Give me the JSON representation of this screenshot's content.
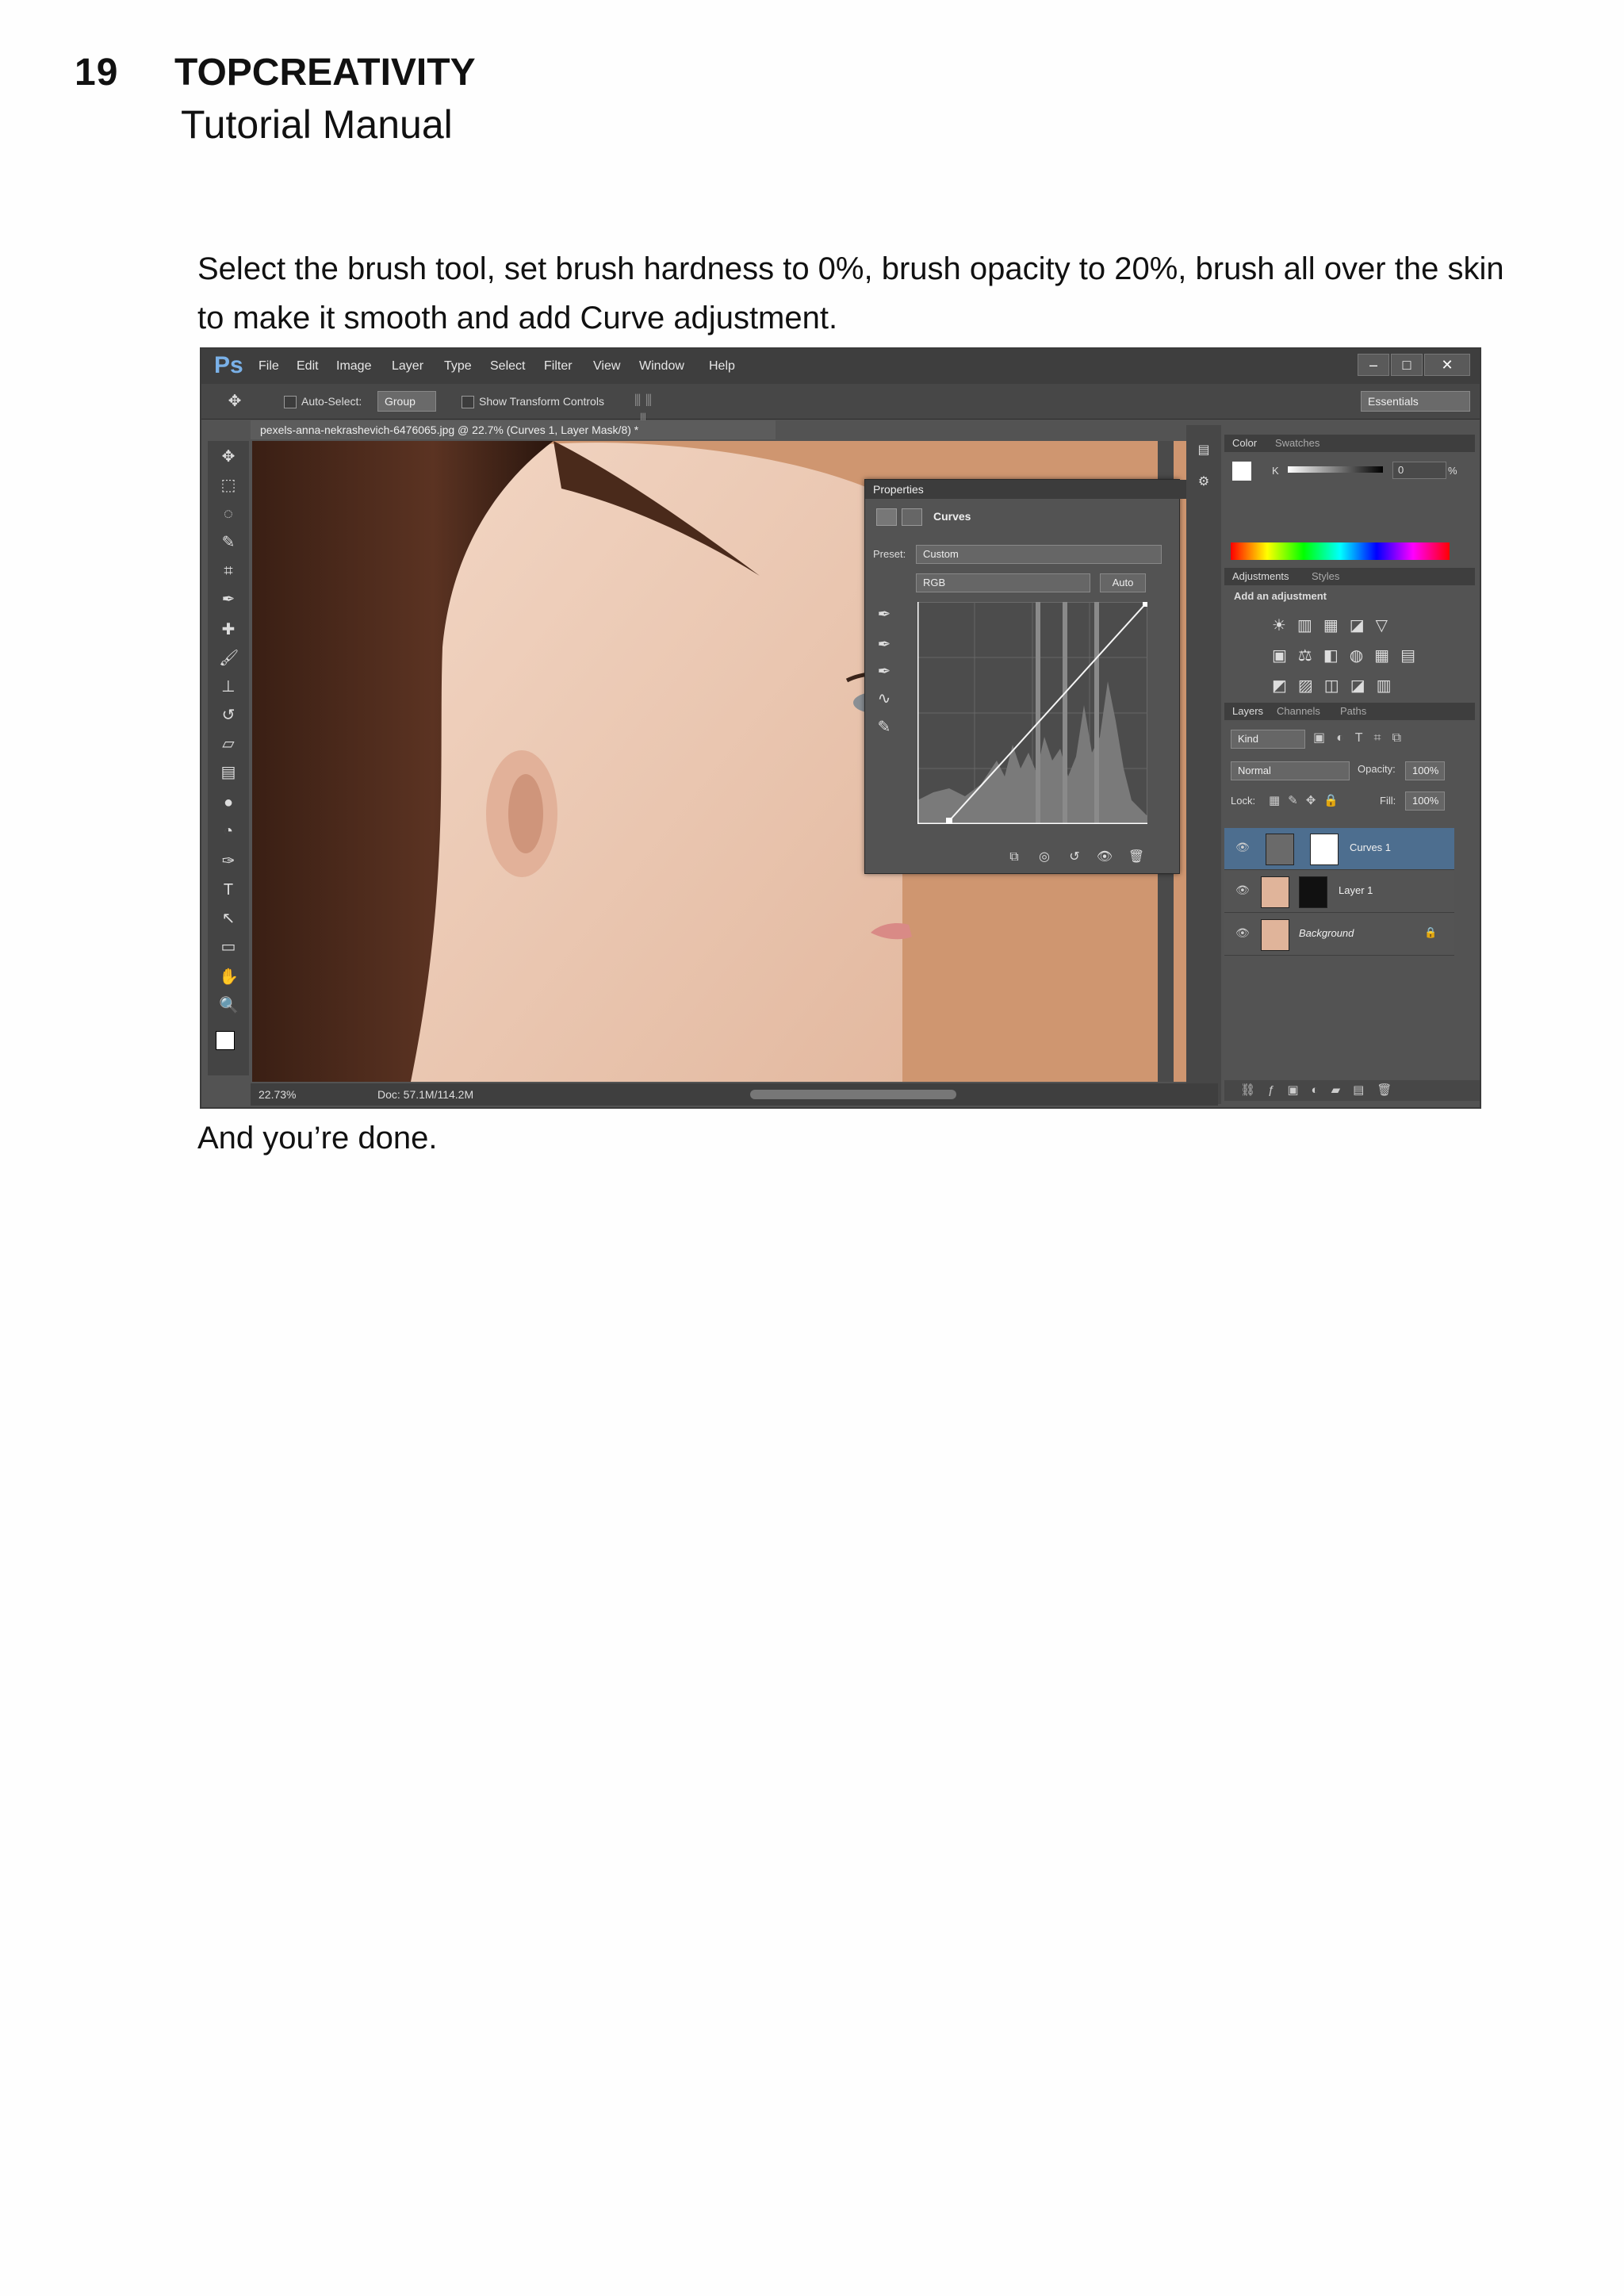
{
  "header": {
    "page_number": "19",
    "brand": "TOPCREATIVITY",
    "subtitle": "Tutorial Manual"
  },
  "paragraphs": {
    "instruction": "Select the brush tool, set brush hardness to 0%, brush opacity to 20%, brush all over the skin to make it smooth and add Curve adjustment.",
    "closing": "And you’re done."
  },
  "screenshot": {
    "app_logo": "Ps",
    "menu": [
      "File",
      "Edit",
      "Image",
      "Layer",
      "Type",
      "Select",
      "Filter",
      "View",
      "Window",
      "Help"
    ],
    "options": {
      "auto_select_label": "Auto-Select:",
      "auto_select_value": "Group",
      "transform_label": "Show Transform Controls",
      "workspace": "Essentials"
    },
    "document_tab": "pexels-anna-nekrashevich-6476065.jpg @ 22.7% (Curves 1, Layer Mask/8) *",
    "status": {
      "zoom": "22.73%",
      "doc": "Doc: 57.1M/114.2M"
    },
    "properties": {
      "title": "Properties",
      "panel_name": "Curves",
      "preset_label": "Preset:",
      "preset_value": "Custom",
      "channel": "RGB",
      "auto_button": "Auto"
    },
    "color_panel": {
      "tabs": [
        "Color",
        "Swatches"
      ],
      "channel": "K",
      "value": "0",
      "unit": "%"
    },
    "adjustments_panel": {
      "tabs": [
        "Adjustments",
        "Styles"
      ],
      "heading": "Add an adjustment"
    },
    "layers_panel": {
      "tabs": [
        "Layers",
        "Channels",
        "Paths"
      ],
      "filter": "Kind",
      "blend_mode": "Normal",
      "opacity_label": "Opacity:",
      "opacity_value": "100%",
      "lock_label": "Lock:",
      "fill_label": "Fill:",
      "fill_value": "100%",
      "layers": [
        "Curves 1",
        "Layer 1",
        "Background"
      ]
    }
  }
}
